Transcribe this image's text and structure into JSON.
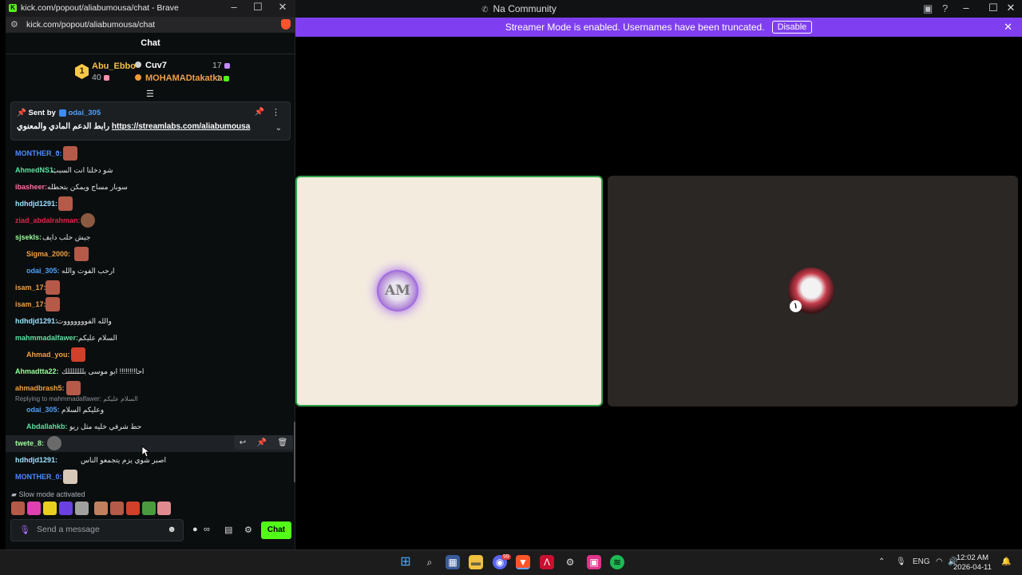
{
  "browser": {
    "title": "kick.com/popout/aliabumousa/chat - Brave",
    "url": "kick.com/popout/aliabumousa/chat"
  },
  "chat": {
    "header": "Chat",
    "leaderboard": [
      {
        "rank": "1",
        "name": "Abu_Ebbo",
        "value": "40"
      },
      {
        "name": "Cuv7",
        "value": "17"
      },
      {
        "name": "MOHAMADtakatka",
        "value": "1"
      }
    ],
    "pinned": {
      "sent_by_prefix": "Sent by",
      "sent_by_user": "odai_305",
      "text": "رابط الدعم المادي والمعنوي",
      "link": "https://streamlabs.com/aliabumousa"
    },
    "messages": [
      {
        "user": "MONTHER_0",
        "text": ""
      },
      {
        "user": "AhmedNS1",
        "text": "شو دخلنا انت السبب"
      },
      {
        "user": "ibasheer",
        "text": "سوبار مساج ويمكن بتحطله"
      },
      {
        "user": "hdhdjd1291",
        "text": ""
      },
      {
        "user": "ziad_abdalrahman",
        "text": ""
      },
      {
        "user": "sjsekls",
        "text": "جيش حلب دايف"
      },
      {
        "user": "Sigma_2000",
        "text": ""
      },
      {
        "user": "odai_305",
        "text": "ارحب الفوت والله"
      },
      {
        "user": "isam_17",
        "text": ""
      },
      {
        "user": "isam_17",
        "text": ""
      },
      {
        "user": "hdhdjd1291",
        "text": "والله الفوووووووت"
      },
      {
        "user": "mahmmadalfawer",
        "text": "السلام عليكم"
      },
      {
        "user": "Ahmad_you",
        "text": ""
      },
      {
        "user": "Ahmadtta22",
        "text": "احا!!!!!!!! ابو موسى بلللللللك"
      },
      {
        "user": "ahmadbrash5",
        "text": ""
      },
      {
        "user": "odai_305",
        "text": "وعليكم السلام",
        "reply": "Replying to mahmmadalfawer: السلام عليكم"
      },
      {
        "user": "Abdallahkb",
        "text": "حط شرفي خليه مثل ريو"
      },
      {
        "user": "twete_8",
        "text": ""
      },
      {
        "user": "hdhdjd1291",
        "text": "اصبر شوي يزم يتجمعو الناس"
      },
      {
        "user": "MONTHER_0",
        "text": ""
      }
    ],
    "slow_mode": "Slow mode activated",
    "input_placeholder": "Send a message",
    "send_label": "Chat"
  },
  "discord": {
    "window_title": "Na Community",
    "streamer_mode_text": "Streamer Mode is enabled. Usernames have been truncated.",
    "disable_label": "Disable",
    "tile2_badge": "١"
  },
  "taskbar": {
    "lang": "ENG",
    "time": "12:02 AM",
    "date": "2026-04-11",
    "discord_badge": "99"
  },
  "colors": {
    "kick_green": "#53fc18",
    "streamer_bar": "#7f3ff0",
    "speaking_border": "#2fa24c"
  }
}
